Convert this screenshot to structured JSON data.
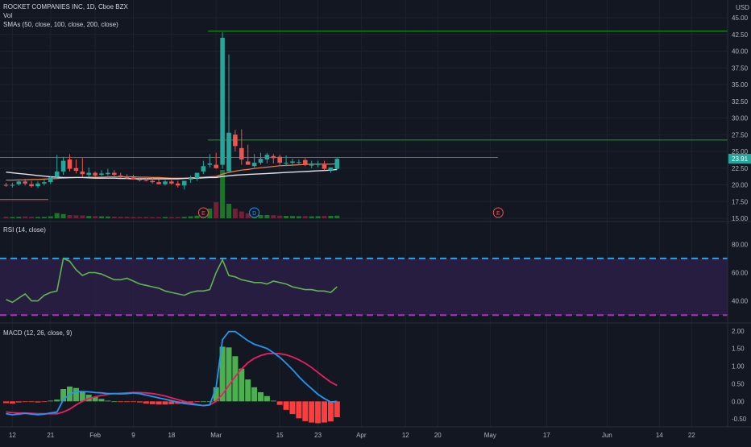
{
  "header": {
    "symbol_line": "ROCKET COMPANIES INC, 1D, Cboe BZX",
    "vol_label": "Vol",
    "sma_label": "SMAs (50, close, 100, close, 200, close)",
    "currency": "USD",
    "last_price": "23.91"
  },
  "rsi_panel": {
    "label": "RSI (14, close)"
  },
  "macd_panel": {
    "label": "MACD (12, 26, close, 9)"
  },
  "colors": {
    "background": "#131722",
    "up": "#26a69a",
    "down": "#ef5350",
    "hline": "#1f9e1f",
    "sma_white": "#e0e3eb",
    "sma_orange": "#f0824a",
    "rsi_line": "#5fb550",
    "rsi_band_upper": "#22a6f2",
    "rsi_band_lower": "#b42cc8",
    "macd_line": "#2196f3",
    "signal_line": "#e91e63",
    "hist_pos": "#4caf50",
    "hist_neg": "#ff3b3b"
  },
  "chart_data": [
    {
      "type": "candlestick",
      "dates": [
        "Jan 11",
        "Jan 12",
        "Jan 13",
        "Jan 14",
        "Jan 15",
        "Jan 19",
        "Jan 20",
        "Jan 21",
        "Jan 22",
        "Jan 25",
        "Jan 26",
        "Jan 27",
        "Jan 28",
        "Jan 29",
        "Feb 1",
        "Feb 2",
        "Feb 3",
        "Feb 4",
        "Feb 5",
        "Feb 8",
        "Feb 9",
        "Feb 10",
        "Feb 11",
        "Feb 12",
        "Feb 16",
        "Feb 17",
        "Feb 18",
        "Feb 19",
        "Feb 22",
        "Feb 23",
        "Feb 24",
        "Feb 25",
        "Feb 26",
        "Mar 1",
        "Mar 2",
        "Mar 3",
        "Mar 4",
        "Mar 5",
        "Mar 8",
        "Mar 9",
        "Mar 10",
        "Mar 11",
        "Mar 12",
        "Mar 15",
        "Mar 16",
        "Mar 17",
        "Mar 18",
        "Mar 19",
        "Mar 22",
        "Mar 23",
        "Mar 24",
        "Mar 25",
        "Mar 26"
      ],
      "open": [
        20.0,
        19.9,
        20.1,
        20.5,
        20.1,
        19.8,
        20.2,
        20.4,
        21.2,
        22.0,
        23.8,
        22.5,
        22.0,
        21.5,
        21.8,
        21.5,
        21.6,
        21.8,
        21.4,
        21.2,
        21.1,
        20.8,
        20.7,
        20.6,
        20.4,
        20.1,
        20.5,
        20.2,
        19.9,
        20.8,
        21.0,
        22.0,
        23.0,
        23.0,
        23.0,
        22.0,
        27.5,
        25.5,
        23.5,
        22.8,
        23.3,
        23.8,
        24.3,
        24.2,
        23.3,
        23.3,
        23.3,
        23.7,
        23.0,
        23.0,
        23.0,
        22.2,
        22.4
      ],
      "high": [
        20.3,
        20.3,
        20.8,
        20.9,
        20.6,
        20.5,
        20.8,
        21.3,
        24.5,
        24.2,
        24.6,
        23.8,
        24.0,
        22.6,
        22.0,
        22.2,
        22.4,
        22.2,
        21.8,
        21.6,
        21.5,
        21.2,
        21.2,
        21.0,
        20.8,
        20.7,
        20.9,
        20.6,
        20.2,
        21.4,
        21.6,
        23.6,
        24.6,
        24.8,
        42.8,
        39.5,
        28.2,
        28.3,
        26.0,
        24.6,
        24.8,
        24.8,
        24.6,
        24.5,
        24.4,
        23.9,
        23.8,
        24.0,
        23.6,
        23.6,
        23.6,
        22.6,
        24.0
      ],
      "low": [
        19.7,
        19.6,
        19.9,
        19.9,
        19.6,
        19.5,
        19.9,
        20.1,
        21.0,
        21.5,
        22.0,
        21.7,
        21.2,
        21.2,
        21.2,
        21.3,
        21.4,
        21.2,
        21.0,
        20.9,
        20.8,
        20.5,
        20.5,
        20.2,
        20.1,
        19.9,
        20.0,
        19.6,
        19.3,
        20.3,
        20.6,
        21.6,
        22.6,
        22.4,
        22.4,
        27.0,
        25.0,
        23.0,
        23.5,
        22.6,
        23.0,
        23.2,
        23.2,
        23.0,
        22.8,
        22.8,
        23.0,
        22.8,
        22.5,
        22.6,
        22.2,
        21.8,
        22.3
      ],
      "close": [
        19.9,
        20.0,
        20.5,
        20.2,
        19.8,
        20.2,
        20.4,
        21.1,
        22.0,
        23.6,
        22.4,
        22.1,
        21.6,
        21.8,
        21.4,
        21.7,
        21.8,
        21.5,
        21.2,
        21.0,
        20.8,
        20.7,
        20.6,
        20.4,
        20.1,
        20.5,
        20.2,
        19.9,
        20.6,
        21.0,
        21.8,
        22.8,
        23.2,
        22.5,
        42.0,
        27.8,
        25.8,
        23.8,
        23.0,
        23.3,
        23.9,
        24.5,
        24.0,
        23.3,
        23.3,
        23.5,
        23.4,
        23.1,
        23.0,
        23.1,
        22.4,
        22.6,
        23.9
      ],
      "ylim": [
        15,
        45
      ],
      "y_ticks": [
        "15.00",
        "17.50",
        "20.00",
        "22.50",
        "25.00",
        "27.50",
        "30.00",
        "32.50",
        "35.00",
        "37.50",
        "40.00",
        "42.50",
        "45.00"
      ],
      "horizontal_levels": [
        43.0,
        26.7,
        24.1,
        17.8
      ],
      "sma_200": [
        21.9,
        21.8,
        21.7,
        21.6,
        21.5,
        21.4,
        21.3,
        21.2,
        21.15,
        21.1,
        21.1,
        21.1,
        21.1,
        21.05,
        21.0,
        21.0,
        21.0,
        21.0,
        20.95,
        20.95,
        20.9,
        20.9,
        20.9,
        20.9,
        20.9,
        20.9,
        20.9,
        20.9,
        20.95,
        21.0,
        21.0,
        21.05,
        21.1,
        21.1,
        21.25,
        21.35,
        21.45,
        21.5,
        21.55,
        21.6,
        21.65,
        21.7,
        21.75,
        21.8,
        21.85,
        21.9,
        21.95,
        22.0,
        22.05,
        22.1,
        22.15,
        22.2,
        22.3
      ],
      "sma_50": [
        20.7,
        20.7,
        20.75,
        20.75,
        20.8,
        20.8,
        20.85,
        20.9,
        20.95,
        21.0,
        21.05,
        21.1,
        21.1,
        21.15,
        21.15,
        21.15,
        21.2,
        21.2,
        21.2,
        21.2,
        21.2,
        21.15,
        21.15,
        21.1,
        21.1,
        21.05,
        21.0,
        21.0,
        21.0,
        21.05,
        21.1,
        21.15,
        21.2,
        21.25,
        21.6,
        21.85,
        22.05,
        22.2,
        22.3,
        22.45,
        22.55,
        22.65,
        22.75,
        22.85,
        22.9,
        22.95,
        23.0,
        23.05,
        23.1,
        23.1,
        23.1,
        23.1,
        23.15
      ],
      "volume": [
        1.0,
        0.8,
        0.9,
        1.1,
        0.9,
        0.8,
        0.9,
        1.2,
        3.2,
        2.6,
        2.0,
        1.8,
        1.7,
        1.4,
        1.3,
        1.2,
        1.1,
        1.0,
        0.9,
        0.9,
        0.8,
        0.8,
        0.8,
        0.7,
        0.7,
        0.8,
        0.7,
        0.8,
        0.9,
        1.2,
        1.6,
        3.5,
        6.0,
        10.0,
        30.0,
        9.0,
        6.0,
        4.2,
        3.0,
        2.4,
        2.0,
        2.0,
        1.9,
        1.6,
        1.5,
        1.4,
        1.3,
        1.3,
        1.2,
        1.3,
        1.4,
        1.5,
        1.6
      ],
      "events": [
        {
          "label": "E",
          "at": "Feb 25"
        },
        {
          "label": "D",
          "at": "Mar 9"
        },
        {
          "label": "E",
          "at": "May 5"
        }
      ]
    },
    {
      "type": "line",
      "name": "RSI",
      "values": [
        41,
        39,
        42,
        45,
        40,
        40,
        44,
        46,
        47,
        70,
        68,
        62,
        58,
        60,
        60,
        59,
        57,
        55,
        55,
        56,
        54,
        52,
        51,
        50,
        49,
        47,
        46,
        45,
        44,
        46,
        47,
        47,
        48,
        60,
        69,
        58,
        57,
        55,
        54,
        53,
        53,
        52,
        54,
        53,
        52,
        50,
        49,
        48,
        48,
        47,
        47,
        46,
        50
      ],
      "ylim": [
        25,
        95
      ],
      "y_ticks": [
        "40.00",
        "60.00",
        "80.00"
      ],
      "bands": [
        70,
        30
      ]
    },
    {
      "type": "line",
      "name": "MACD",
      "macd": [
        -0.35,
        -0.38,
        -0.36,
        -0.34,
        -0.36,
        -0.38,
        -0.36,
        -0.33,
        -0.3,
        0.05,
        0.2,
        0.28,
        0.28,
        0.27,
        0.25,
        0.24,
        0.22,
        0.22,
        0.21,
        0.22,
        0.24,
        0.22,
        0.18,
        0.14,
        0.1,
        0.06,
        0.02,
        -0.02,
        -0.06,
        -0.08,
        -0.1,
        -0.12,
        -0.1,
        0.4,
        1.75,
        1.98,
        1.98,
        1.85,
        1.72,
        1.62,
        1.56,
        1.5,
        1.38,
        1.25,
        1.08,
        0.9,
        0.7,
        0.52,
        0.36,
        0.2,
        0.08,
        -0.02,
        0.0
      ],
      "signal": [
        -0.3,
        -0.32,
        -0.33,
        -0.33,
        -0.34,
        -0.35,
        -0.35,
        -0.35,
        -0.35,
        -0.3,
        -0.22,
        -0.1,
        0.0,
        0.08,
        0.13,
        0.17,
        0.2,
        0.22,
        0.23,
        0.24,
        0.25,
        0.25,
        0.24,
        0.22,
        0.19,
        0.15,
        0.1,
        0.05,
        0.0,
        -0.05,
        -0.09,
        -0.12,
        -0.1,
        0.0,
        0.2,
        0.45,
        0.7,
        0.92,
        1.1,
        1.22,
        1.3,
        1.35,
        1.36,
        1.35,
        1.32,
        1.26,
        1.18,
        1.08,
        0.96,
        0.82,
        0.68,
        0.55,
        0.45
      ],
      "histogram": [
        -0.05,
        -0.06,
        -0.03,
        -0.01,
        -0.02,
        -0.03,
        -0.01,
        0.02,
        0.05,
        0.35,
        0.42,
        0.38,
        0.28,
        0.19,
        0.12,
        0.07,
        0.02,
        0.0,
        -0.02,
        -0.02,
        -0.01,
        -0.03,
        -0.06,
        -0.08,
        -0.09,
        -0.09,
        -0.08,
        -0.07,
        -0.06,
        -0.03,
        -0.01,
        0.0,
        0.0,
        0.4,
        1.55,
        1.53,
        1.28,
        0.93,
        0.62,
        0.4,
        0.26,
        0.15,
        0.02,
        -0.1,
        -0.24,
        -0.36,
        -0.48,
        -0.56,
        -0.6,
        -0.62,
        -0.6,
        -0.57,
        -0.45
      ],
      "ylim": [
        -0.7,
        2.2
      ],
      "y_ticks": [
        "-0.50",
        "0.00",
        "0.50",
        "1.00",
        "1.50",
        "2.00"
      ]
    }
  ],
  "x_axis": {
    "labels": [
      "12",
      "21",
      "Feb",
      "9",
      "18",
      "Mar",
      "15",
      "23",
      "Apr",
      "12",
      "20",
      "May",
      "17",
      "Jun",
      "14",
      "22"
    ],
    "label_dates": [
      "Jan 12",
      "Jan 21",
      "Feb 1",
      "Feb 9",
      "Feb 18",
      "Mar 1",
      "Mar 15",
      "Mar 23",
      "Apr 1",
      "Apr 12",
      "Apr 20",
      "May 3",
      "May 17",
      "Jun 1",
      "Jun 14",
      "Jun 22"
    ]
  }
}
